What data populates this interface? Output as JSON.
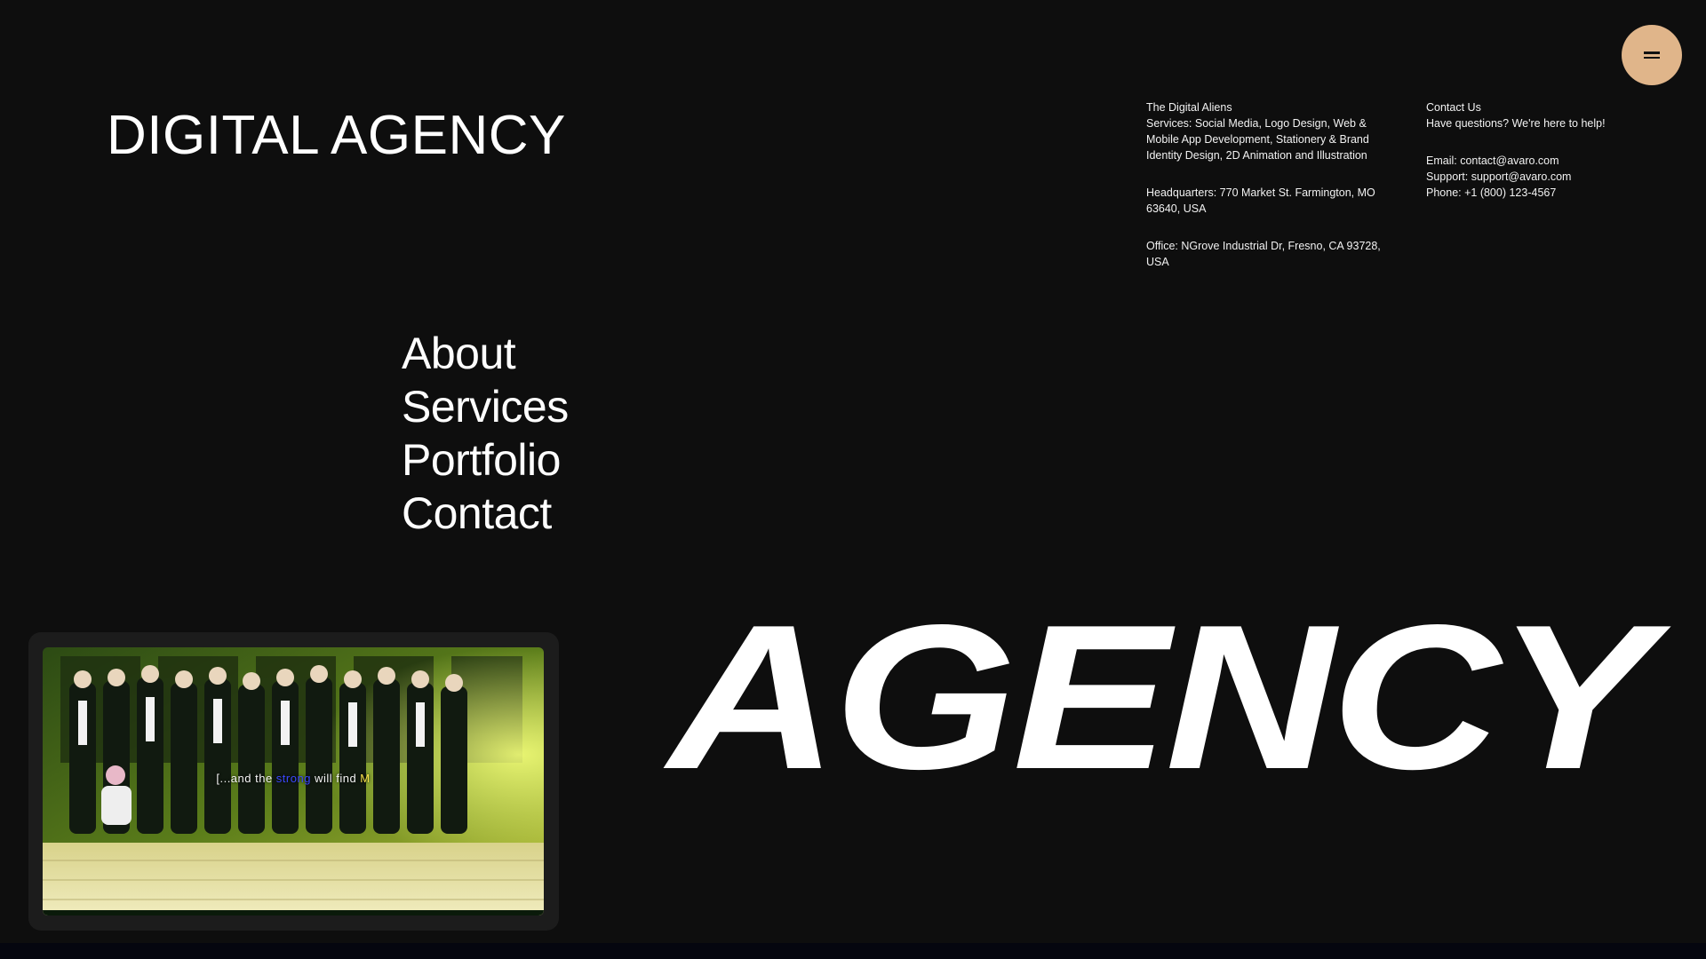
{
  "header": {
    "brand_title": "DIGITAL AGENCY",
    "menu_button_icon": "menu-lines-icon",
    "menu_button_color": "#e0b58a"
  },
  "nav": {
    "items": [
      {
        "label": "About"
      },
      {
        "label": "Services"
      },
      {
        "label": "Portfolio"
      },
      {
        "label": "Contact"
      }
    ]
  },
  "info": {
    "company_name": "The Digital Aliens",
    "services": "Services: Social Media, Logo Design, Web & Mobile App Development, Stationery & Brand Identity Design, 2D Animation and Illustration",
    "headquarters": "Headquarters: 770 Market St. Farmington, MO 63640, USA",
    "office": "Office: NGrove Industrial Dr, Fresno, CA 93728, USA",
    "contact_title": "Contact Us",
    "contact_subtitle": "Have questions? We're here to help!",
    "email": "Email: contact@avaro.com",
    "support": "Support: support@avaro.com",
    "phone": "Phone: +1 (800) 123-4567"
  },
  "video": {
    "caption_part1": "[...and the ",
    "caption_part2": "strong",
    "caption_part3": " will find ",
    "caption_part4": "M"
  },
  "hero": {
    "big_word": "AGENCY"
  },
  "colors": {
    "background": "#0e0e0e",
    "text": "#ffffff",
    "accent": "#e0b58a"
  }
}
